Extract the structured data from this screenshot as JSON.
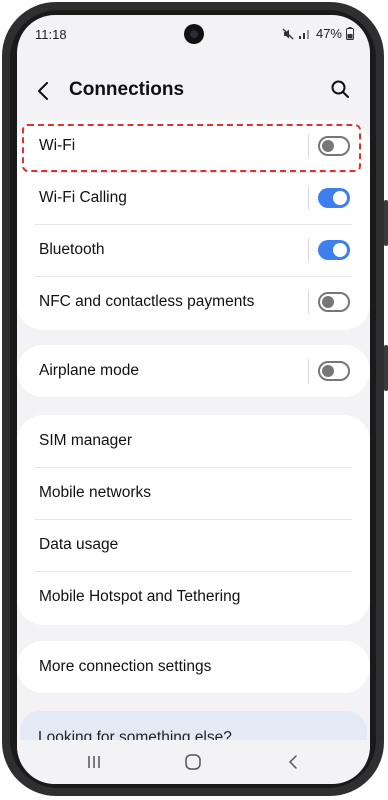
{
  "status_bar": {
    "time": "11:18",
    "battery": "47%"
  },
  "header": {
    "title": "Connections"
  },
  "groups": [
    {
      "items": [
        {
          "label": "Wi-Fi",
          "toggle": "off"
        },
        {
          "label": "Wi-Fi Calling",
          "toggle": "on"
        },
        {
          "label": "Bluetooth",
          "toggle": "on"
        },
        {
          "label": "NFC and contactless payments",
          "toggle": "off"
        }
      ]
    },
    {
      "items": [
        {
          "label": "Airplane mode",
          "toggle": "off"
        }
      ]
    },
    {
      "items": [
        {
          "label": "SIM manager"
        },
        {
          "label": "Mobile networks"
        },
        {
          "label": "Data usage"
        },
        {
          "label": "Mobile Hotspot and Tethering"
        }
      ]
    },
    {
      "items": [
        {
          "label": "More connection settings"
        }
      ]
    }
  ],
  "suggestion": {
    "label": "Looking for something else?"
  },
  "colors": {
    "accent": "#3e7ff0",
    "highlight": "#e03131",
    "background": "#f3f3f6"
  },
  "icons": [
    "back-arrow-icon",
    "search-icon",
    "mute-icon",
    "signal-icon",
    "battery-icon",
    "recents-icon",
    "home-icon",
    "back-nav-icon"
  ]
}
